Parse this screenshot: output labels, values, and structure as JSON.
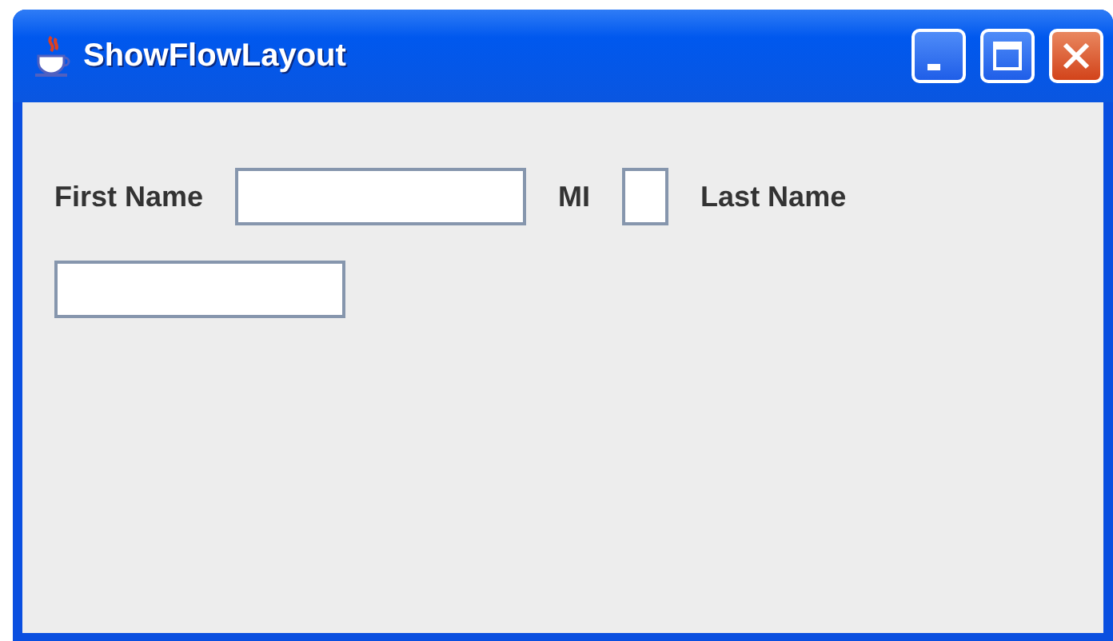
{
  "window": {
    "title": "ShowFlowLayout"
  },
  "controls": [
    {
      "kind": "label",
      "text": "First Name"
    },
    {
      "kind": "field"
    },
    {
      "kind": "label",
      "text": "MI"
    },
    {
      "kind": "narrow_field"
    },
    {
      "kind": "label",
      "text": "Last Name"
    },
    {
      "kind": "field"
    }
  ]
}
